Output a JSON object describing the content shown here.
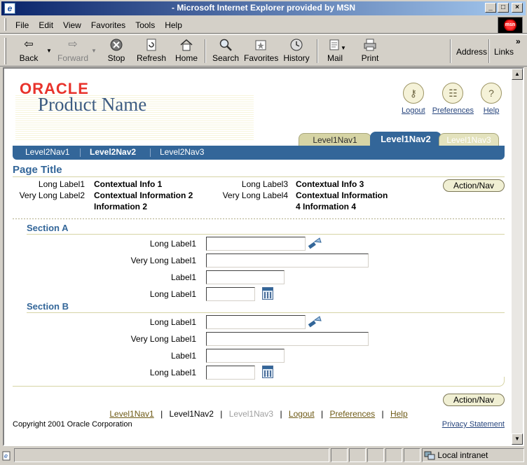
{
  "window": {
    "title": "- Microsoft Internet Explorer provided by MSN",
    "controls": [
      "_",
      "□",
      "×"
    ]
  },
  "menu": [
    "File",
    "Edit",
    "View",
    "Favorites",
    "Tools",
    "Help"
  ],
  "toolbar": {
    "back": "Back",
    "forward": "Forward",
    "stop": "Stop",
    "refresh": "Refresh",
    "home": "Home",
    "search": "Search",
    "favorites": "Favorites",
    "history": "History",
    "mail": "Mail",
    "print": "Print",
    "address": "Address",
    "links": "Links",
    "more": "»"
  },
  "branding": {
    "company": "ORACLE",
    "product": "Product Name"
  },
  "global_buttons": [
    {
      "label": "Logout",
      "icon": "key-icon"
    },
    {
      "label": "Preferences",
      "icon": "preferences-icon"
    },
    {
      "label": "Help",
      "icon": "help-icon"
    }
  ],
  "level1_tabs": [
    {
      "label": "Level1Nav1",
      "state": "normal"
    },
    {
      "label": "Level1Nav2",
      "state": "active"
    },
    {
      "label": "Level1Nav3",
      "state": "disabled"
    }
  ],
  "level2_nav": [
    {
      "label": "Level2Nav1",
      "state": "normal"
    },
    {
      "label": "Level2Nav2",
      "state": "active"
    },
    {
      "label": "Level2Nav3",
      "state": "normal"
    }
  ],
  "page": {
    "title": "Page Title",
    "contextual": {
      "label1": "Long Label1",
      "value1": "Contextual Info 1",
      "label2": "Very Long Label2",
      "value2a": "Contextual Information 2",
      "value2b": "Information 2",
      "label3": "Long Label3",
      "value3": "Contextual Info 3",
      "label4": "Very Long Label4",
      "value4a": "Contextual Information",
      "value4b": "4 Information 4"
    },
    "action_nav": "Action/Nav"
  },
  "sections": [
    {
      "title": "Section A",
      "fields": [
        {
          "label": "Long Label1",
          "value": ""
        },
        {
          "label": "Very Long Label1",
          "value": ""
        },
        {
          "label": "Label1",
          "value": ""
        },
        {
          "label": "Long Label1",
          "value": ""
        }
      ]
    },
    {
      "title": "Section B",
      "fields": [
        {
          "label": "Long Label1",
          "value": ""
        },
        {
          "label": "Very Long Label1",
          "value": ""
        },
        {
          "label": "Label1",
          "value": ""
        },
        {
          "label": "Long Label1",
          "value": ""
        }
      ]
    }
  ],
  "footer": {
    "links": [
      "Level1Nav1",
      "Level1Nav2",
      "Level1Nav3",
      "Logout",
      "Preferences",
      "Help"
    ],
    "separator": "|",
    "copyright": "Copyright 2001 Oracle Corporation",
    "privacy": "Privacy Statement"
  },
  "status": {
    "zone": "Local intranet"
  },
  "colors": {
    "brand_blue": "#336699",
    "oracle_red": "#e8332c",
    "tab_beige": "#d6d4a5",
    "link_brown": "#6e5a16"
  }
}
